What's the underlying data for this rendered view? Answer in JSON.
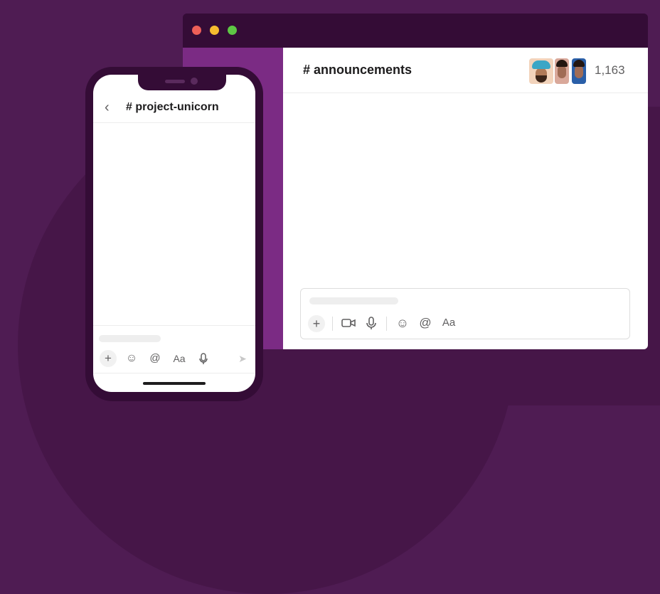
{
  "desktop": {
    "channel_title": "# announcements",
    "member_count": "1,163",
    "composer": {
      "tools": [
        {
          "icon": "plus-icon",
          "glyph": "+"
        },
        {
          "icon": "video-icon",
          "glyph": "▭"
        },
        {
          "icon": "microphone-icon",
          "glyph": "🎙"
        },
        {
          "icon": "emoji-icon",
          "glyph": "☺"
        },
        {
          "icon": "mention-icon",
          "glyph": "@"
        },
        {
          "icon": "formatting-icon",
          "glyph": "Aa"
        }
      ]
    }
  },
  "mobile": {
    "back_glyph": "‹",
    "channel_title": "# project-unicorn",
    "composer": {
      "tools": [
        {
          "icon": "plus-icon",
          "glyph": "+"
        },
        {
          "icon": "emoji-icon",
          "glyph": "☺"
        },
        {
          "icon": "mention-icon",
          "glyph": "@"
        },
        {
          "icon": "formatting-icon",
          "glyph": "Aa"
        },
        {
          "icon": "microphone-icon",
          "glyph": "🎙"
        },
        {
          "icon": "send-icon",
          "glyph": "➤"
        }
      ]
    }
  },
  "colors": {
    "background": "#4f1c53",
    "sidebar": "#7b2b84",
    "frame": "#340c36"
  }
}
